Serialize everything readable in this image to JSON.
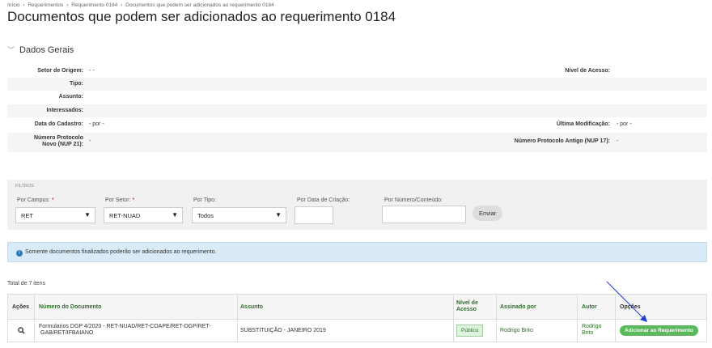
{
  "breadcrumb": [
    "Início",
    "Requerimentos",
    "Requerimento 0184",
    "Documentos que podem ser adicionados ao requerimento 0184"
  ],
  "breadcrumb_sep": "›",
  "page_title": "Documentos que podem ser adicionados ao requerimento 0184",
  "dados_gerais": {
    "title": "Dados Gerais",
    "setor_origem_label": "Setor de Origem:",
    "setor_origem_value": "- -",
    "nivel_acesso_label": "Nível de Acesso:",
    "tipo_label": "Tipo:",
    "assunto_label": "Assunto:",
    "interessados_label": "Interessados:",
    "data_cadastro_label": "Data do Cadastro:",
    "data_cadastro_value": "- por -",
    "ultima_mod_label": "Última Modificação:",
    "ultima_mod_value": "- por -",
    "nup21_label_1": "Número Protocolo",
    "nup21_label_2": "Novo (NUP 21):",
    "nup21_value": "-",
    "nup17_label": "Número Protocolo Antigo (NUP 17):",
    "nup17_value": "-"
  },
  "filtros": {
    "title": "FILTROS",
    "campus_label": "Por Campus:",
    "campus_value": "RET",
    "setor_label": "Por Setor:",
    "setor_value": "RET-NUAD",
    "tipo_label": "Por Tipo:",
    "tipo_value": "Todos",
    "data_label": "Por Data de Criação:",
    "numero_label": "Por Número/Conteúdo:",
    "required_mark": "*",
    "enviar_label": "Enviar"
  },
  "alert_text": "Somente documentos finalizados poderão ser adicionados ao requerimento.",
  "total_text": "Total de 7 itens",
  "table": {
    "headers": {
      "acoes": "Ações",
      "numero": "Número do Documento",
      "assunto": "Assunto",
      "nivel_1": "Nível de",
      "nivel_2": "Acesso",
      "assinado": "Assinado por",
      "autor": "Autor",
      "opcoes": "Opções"
    },
    "rows": [
      {
        "numero_1": "Formularios DGP 4/2020 - RET-NUAD/RET-COAPE/RET-DGP/RET-",
        "numero_2": "GAB/RET/IFBAIANO",
        "assunto": "SUBSTITUIÇÃO - JANEIRO 2019",
        "nivel": "Público",
        "assinado": "Rodrigo Brito",
        "autor_1": "Rodrigo",
        "autor_2": "Brito",
        "action_label": "Adicionar ao Requerimento"
      }
    ]
  },
  "colors": {
    "accent_green": "#2e6e2a",
    "button_green": "#5cb85c",
    "alert_bg": "#d8ebf7",
    "arrow": "#1f3fd6"
  }
}
